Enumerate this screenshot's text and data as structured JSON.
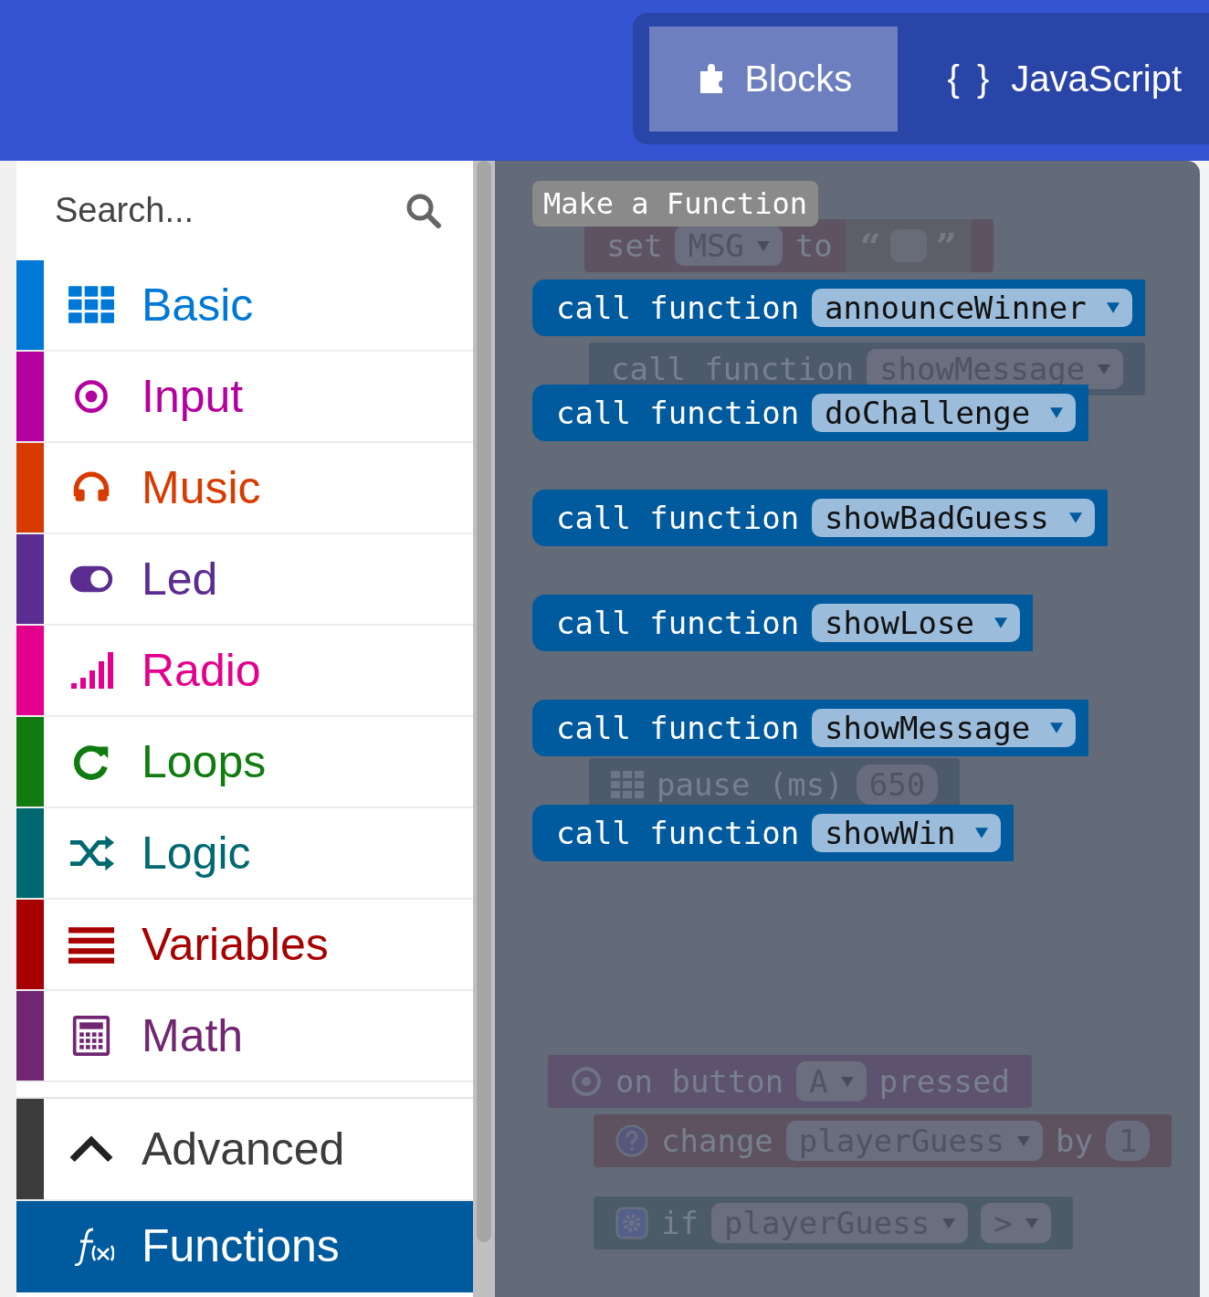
{
  "header": {
    "tabs": [
      {
        "label": "Blocks",
        "selected": true
      },
      {
        "label": "JavaScript",
        "glyph": "{ }",
        "selected": false
      }
    ]
  },
  "toolbox": {
    "search": {
      "placeholder": "Search..."
    },
    "categories": [
      {
        "name": "Basic",
        "color": "#0078d7",
        "selected": false
      },
      {
        "name": "Input",
        "color": "#b4009e",
        "selected": false
      },
      {
        "name": "Music",
        "color": "#d83b01",
        "selected": false
      },
      {
        "name": "Led",
        "color": "#5c2d91",
        "selected": false
      },
      {
        "name": "Radio",
        "color": "#e3008c",
        "selected": false
      },
      {
        "name": "Loops",
        "color": "#107c10",
        "selected": false
      },
      {
        "name": "Logic",
        "color": "#006970",
        "selected": false
      },
      {
        "name": "Variables",
        "color": "#a80000",
        "selected": false
      },
      {
        "name": "Math",
        "color": "#712672",
        "selected": false
      }
    ],
    "advanced": {
      "label": "Advanced",
      "expanded": true,
      "color": "#3c3c3c"
    },
    "extra": [
      {
        "name": "Functions",
        "color": "#005a9e",
        "selected": true
      }
    ]
  },
  "flyout": {
    "button": "Make a Function",
    "blocks": [
      {
        "label": "call function",
        "value": "announceWinner"
      },
      {
        "label": "call function",
        "value": "doChallenge"
      },
      {
        "label": "call function",
        "value": "showBadGuess"
      },
      {
        "label": "call function",
        "value": "showLose"
      },
      {
        "label": "call function",
        "value": "showMessage"
      },
      {
        "label": "call function",
        "value": "showWin"
      }
    ]
  },
  "workspace_blocks": [
    {
      "color": "#5e5363",
      "parts": [
        {
          "kind": "label",
          "text": "set"
        },
        {
          "kind": "dropdown",
          "text": "MSG"
        },
        {
          "kind": "label",
          "text": "to"
        },
        {
          "kind": "string",
          "open": "“",
          "close": "”"
        }
      ]
    },
    {
      "color": "#4d5a6c",
      "parts": [
        {
          "kind": "label",
          "text": "call function"
        },
        {
          "kind": "dropdown",
          "text": "showMessage"
        }
      ]
    },
    {
      "color": "#4d5a6c",
      "parts": [
        {
          "kind": "label",
          "text": "pause (ms)"
        },
        {
          "kind": "number",
          "text": "650"
        }
      ]
    },
    {
      "color": "#5d536f",
      "parts": [
        {
          "kind": "label",
          "text": "on button"
        },
        {
          "kind": "dropdown",
          "text": "A"
        },
        {
          "kind": "label",
          "text": "pressed"
        }
      ]
    },
    {
      "color": "#5e5260",
      "parts": [
        {
          "kind": "label",
          "text": "change"
        },
        {
          "kind": "dropdown",
          "text": "playerGuess"
        },
        {
          "kind": "label",
          "text": "by"
        },
        {
          "kind": "number",
          "text": "1"
        }
      ]
    },
    {
      "color": "#4b5c68",
      "parts": [
        {
          "kind": "label",
          "text": "if"
        },
        {
          "kind": "dropdown",
          "text": "playerGuess"
        },
        {
          "kind": "dropdown",
          "text": ">"
        }
      ]
    }
  ]
}
